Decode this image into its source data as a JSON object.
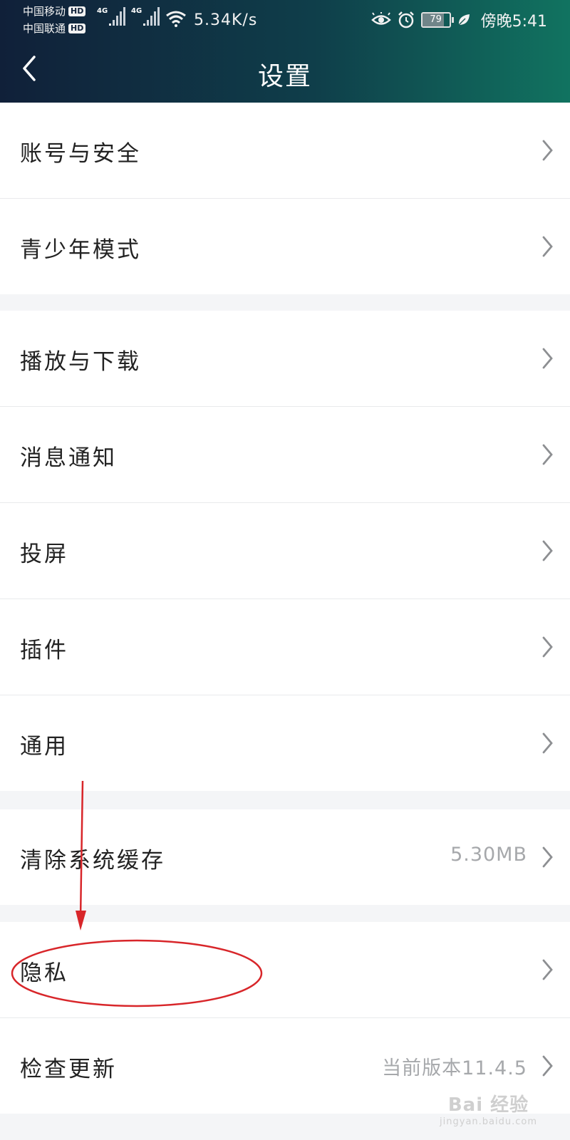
{
  "status_bar": {
    "carrier1": "中国移动",
    "carrier2": "中国联通",
    "hd_badge": "HD",
    "network1": "4G",
    "network2": "4G",
    "speed": "5.34K/s",
    "battery_level": "79",
    "time": "傍晚5:41",
    "icons": [
      "eye-icon",
      "alarm-icon",
      "battery-icon",
      "leaf-icon",
      "wifi-icon",
      "signal-icon"
    ]
  },
  "header": {
    "title": "设置",
    "back_icon": "chevron-left-icon"
  },
  "groups": [
    {
      "items": [
        {
          "label": "账号与安全"
        },
        {
          "label": "青少年模式"
        }
      ]
    },
    {
      "items": [
        {
          "label": "播放与下载"
        },
        {
          "label": "消息通知"
        },
        {
          "label": "投屏"
        },
        {
          "label": "插件"
        },
        {
          "label": "通用"
        }
      ]
    },
    {
      "items": [
        {
          "label": "清除系统缓存",
          "value": "5.30MB"
        }
      ]
    },
    {
      "items": [
        {
          "label": "隐私"
        },
        {
          "label": "检查更新",
          "value": "当前版本11.4.5"
        }
      ]
    }
  ],
  "watermark": {
    "main": "Bai 经验",
    "sub": "jingyan.baidu.com"
  },
  "colors": {
    "header_start": "#102039",
    "header_end": "#117360",
    "annotation": "#d8262a",
    "page_bg": "#f4f5f7"
  }
}
